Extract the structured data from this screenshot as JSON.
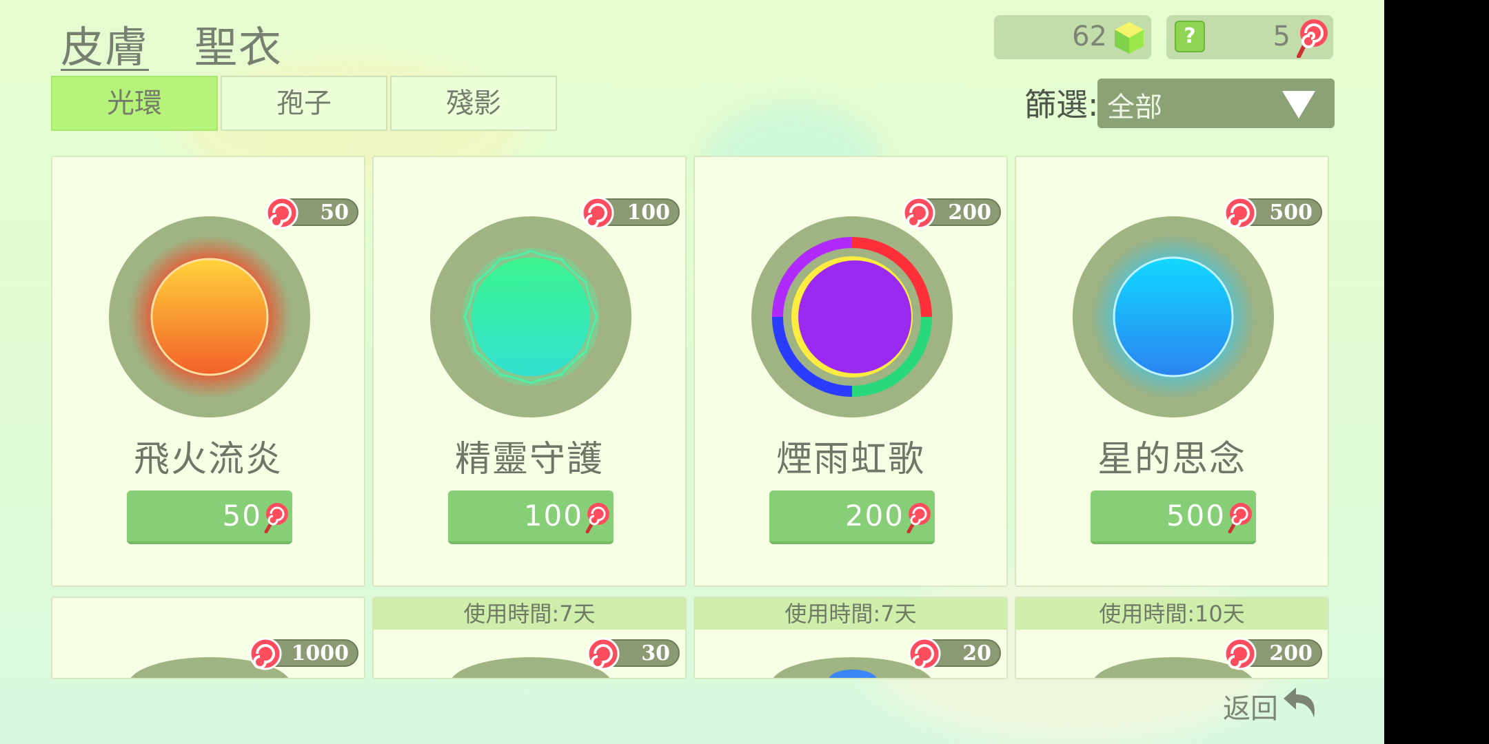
{
  "tabs": [
    {
      "label": "皮膚",
      "active": true
    },
    {
      "label": "聖衣",
      "active": false
    }
  ],
  "currency": {
    "gems": "62",
    "help_icon": "?",
    "lollipops": "5"
  },
  "sub_tabs": [
    {
      "label": "光環",
      "active": true
    },
    {
      "label": "孢子",
      "active": false
    },
    {
      "label": "殘影",
      "active": false
    }
  ],
  "filter": {
    "label": "篩選:",
    "value": "全部"
  },
  "cards": [
    {
      "name": "飛火流炎",
      "badge": "50",
      "price": "50",
      "orb": "fire"
    },
    {
      "name": "精靈守護",
      "badge": "100",
      "price": "100",
      "orb": "spirit"
    },
    {
      "name": "煙雨虹歌",
      "badge": "200",
      "price": "200",
      "orb": "rainbow"
    },
    {
      "name": "星的思念",
      "badge": "500",
      "price": "500",
      "orb": "star"
    }
  ],
  "cards_row2": [
    {
      "badge": "1000",
      "time": ""
    },
    {
      "badge": "30",
      "time": "使用時間:7天"
    },
    {
      "badge": "20",
      "time": "使用時間:7天"
    },
    {
      "badge": "200",
      "time": "使用時間:10天"
    }
  ],
  "back_label": "返回",
  "icons": {
    "gem": "green-hexagon-gem-icon",
    "lollipop": "swirl-lollipop-icon",
    "back": "back-arrow-icon",
    "dropdown": "triangle-down-icon"
  }
}
